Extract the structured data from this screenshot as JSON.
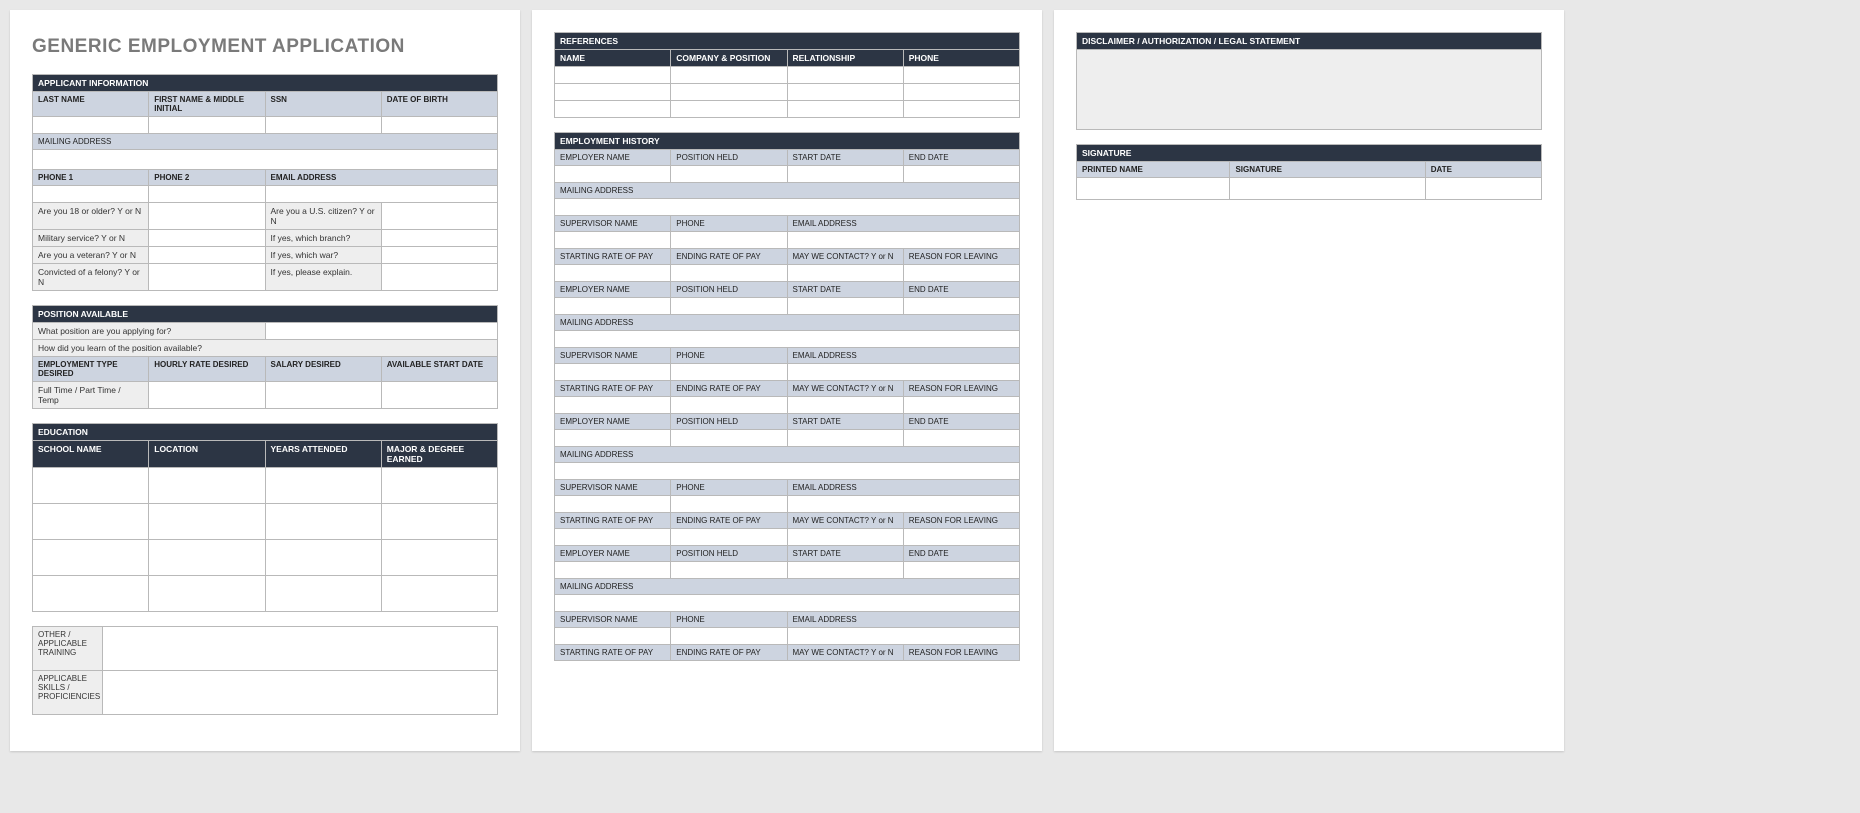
{
  "title": "GENERIC EMPLOYMENT APPLICATION",
  "page1": {
    "applicant": {
      "section": "APPLICANT INFORMATION",
      "last_name": "LAST NAME",
      "first_name": "FIRST NAME & MIDDLE INITIAL",
      "ssn": "SSN",
      "dob": "DATE OF BIRTH",
      "mailing": "MAILING ADDRESS",
      "phone1": "PHONE 1",
      "phone2": "PHONE 2",
      "email": "EMAIL ADDRESS",
      "q_age": "Are you 18 or older?  Y or N",
      "q_citizen": "Are you a U.S. citizen?  Y or N",
      "q_military": "Military service?  Y or N",
      "q_branch": "If yes, which branch?",
      "q_veteran": "Are you a veteran?  Y or N",
      "q_war": "If yes, which war?",
      "q_felony": "Convicted of a felony?  Y or N",
      "q_explain": "If yes, please explain."
    },
    "position": {
      "section": "POSITION AVAILABLE",
      "q_position": "What position are you applying for?",
      "q_learn": "How did you learn of the position available?",
      "emp_type": "EMPLOYMENT TYPE DESIRED",
      "hourly": "HOURLY RATE DESIRED",
      "salary": "SALARY DESIRED",
      "start": "AVAILABLE START DATE",
      "ft_pt": "Full Time / Part Time / Temp"
    },
    "education": {
      "section": "EDUCATION",
      "school": "SCHOOL NAME",
      "location": "LOCATION",
      "years": "YEARS ATTENDED",
      "major": "MAJOR & DEGREE EARNED",
      "other": "OTHER / APPLICABLE TRAINING",
      "skills": "APPLICABLE SKILLS / PROFICIENCIES"
    }
  },
  "page2": {
    "references": {
      "section": "REFERENCES",
      "name": "NAME",
      "company": "COMPANY & POSITION",
      "relationship": "RELATIONSHIP",
      "phone": "PHONE"
    },
    "history": {
      "section": "EMPLOYMENT HISTORY",
      "employer": "EMPLOYER NAME",
      "position": "POSITION HELD",
      "start": "START DATE",
      "end": "END DATE",
      "mailing": "MAILING ADDRESS",
      "supervisor": "SUPERVISOR NAME",
      "phone": "PHONE",
      "email": "EMAIL ADDRESS",
      "start_pay": "STARTING RATE OF PAY",
      "end_pay": "ENDING RATE OF PAY",
      "contact": "MAY WE CONTACT? Y or N",
      "reason": "REASON FOR LEAVING"
    }
  },
  "page3": {
    "disclaimer": {
      "section": "DISCLAIMER / AUTHORIZATION / LEGAL STATEMENT"
    },
    "signature": {
      "section": "SIGNATURE",
      "printed": "PRINTED NAME",
      "sig": "SIGNATURE",
      "date": "DATE"
    }
  }
}
